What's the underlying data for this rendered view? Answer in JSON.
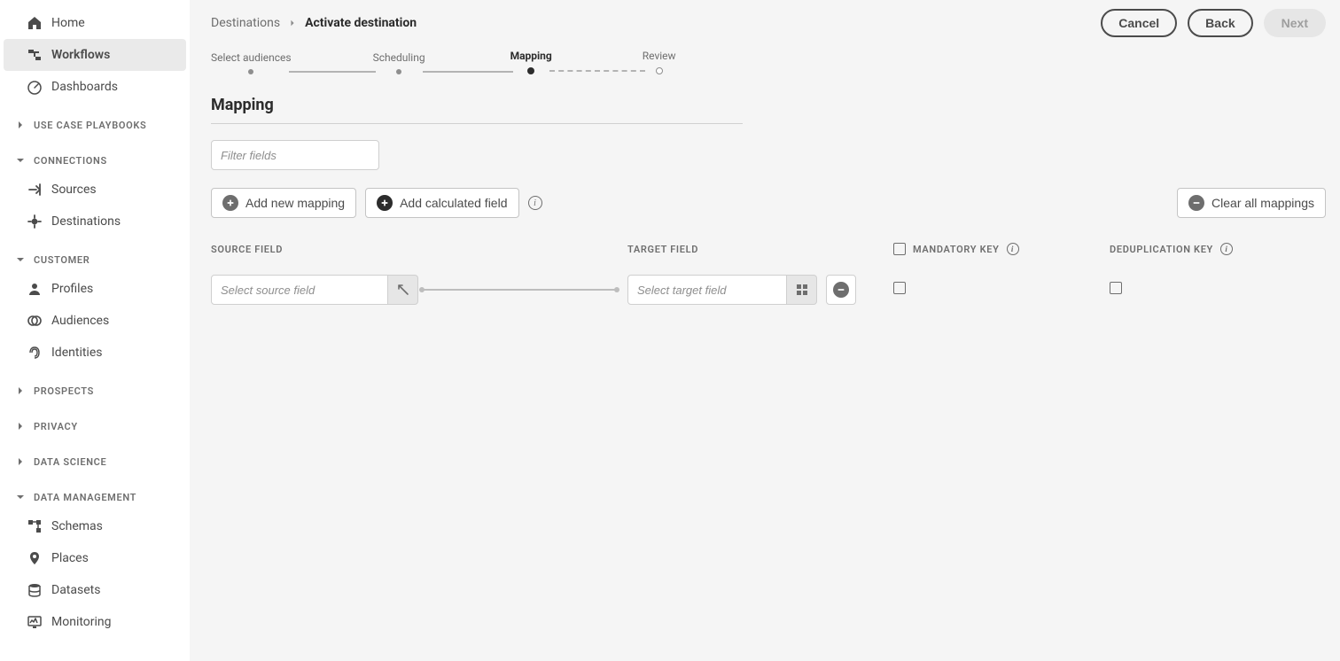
{
  "sidebar": {
    "items_top": [
      {
        "label": "Home",
        "icon": "home"
      },
      {
        "label": "Workflows",
        "icon": "workflow",
        "active": true
      },
      {
        "label": "Dashboards",
        "icon": "dashboard"
      }
    ],
    "groups": [
      {
        "label": "USE CASE PLAYBOOKS",
        "expanded": false,
        "items": []
      },
      {
        "label": "CONNECTIONS",
        "expanded": true,
        "items": [
          {
            "label": "Sources",
            "icon": "sources"
          },
          {
            "label": "Destinations",
            "icon": "destinations"
          }
        ]
      },
      {
        "label": "CUSTOMER",
        "expanded": true,
        "items": [
          {
            "label": "Profiles",
            "icon": "profile"
          },
          {
            "label": "Audiences",
            "icon": "audiences"
          },
          {
            "label": "Identities",
            "icon": "identities"
          }
        ]
      },
      {
        "label": "PROSPECTS",
        "expanded": false,
        "items": []
      },
      {
        "label": "PRIVACY",
        "expanded": false,
        "items": []
      },
      {
        "label": "DATA SCIENCE",
        "expanded": false,
        "items": []
      },
      {
        "label": "DATA MANAGEMENT",
        "expanded": true,
        "items": [
          {
            "label": "Schemas",
            "icon": "schemas"
          },
          {
            "label": "Places",
            "icon": "places"
          },
          {
            "label": "Datasets",
            "icon": "datasets"
          },
          {
            "label": "Monitoring",
            "icon": "monitoring"
          }
        ]
      }
    ]
  },
  "header": {
    "breadcrumb_root": "Destinations",
    "breadcrumb_current": "Activate destination",
    "cancel_label": "Cancel",
    "back_label": "Back",
    "next_label": "Next"
  },
  "stepper": {
    "steps": [
      {
        "label": "Select audiences"
      },
      {
        "label": "Scheduling"
      },
      {
        "label": "Mapping",
        "current": true
      },
      {
        "label": "Review"
      }
    ]
  },
  "page": {
    "title": "Mapping",
    "filter_placeholder": "Filter fields",
    "add_mapping_label": "Add new mapping",
    "add_calculated_label": "Add calculated field",
    "clear_label": "Clear all mappings",
    "columns": {
      "source": "SOURCE FIELD",
      "target": "TARGET FIELD",
      "mandatory": "MANDATORY KEY",
      "dedup": "DEDUPLICATION KEY"
    },
    "row": {
      "source_placeholder": "Select source field",
      "target_placeholder": "Select target field"
    }
  }
}
